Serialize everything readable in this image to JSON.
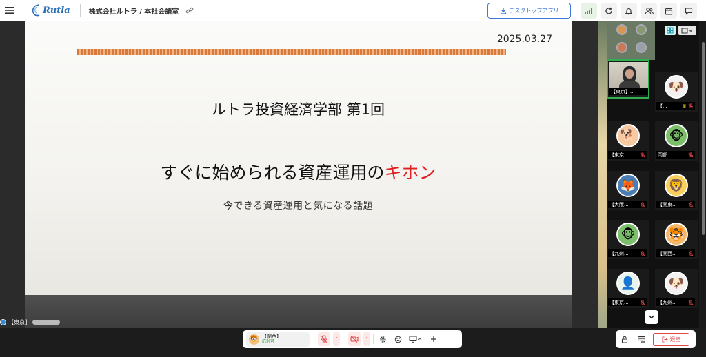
{
  "header": {
    "logo_text": "Rutla",
    "room_title": "株式会社ルトラ / 本社会議室",
    "desktop_app_label": "デスクトップアプリ"
  },
  "slide": {
    "date": "2025.03.27",
    "title": "ルトラ投資経済学部 第1回",
    "headline_main": "すぐに始められる資産運用の",
    "headline_accent": "キホン",
    "subtitle": "今できる資産運用と気になる話題",
    "accent_color": "#e02020",
    "stripe_color": "#d97a3a"
  },
  "self_view": {
    "label": "【東京】"
  },
  "participants": [
    {
      "name": "【東京】...",
      "avatar": "camera-feed",
      "speaking": true,
      "host": false
    },
    {
      "name": "【...",
      "avatar": "pug",
      "speaking": false,
      "host": true
    },
    {
      "name": "【東京...",
      "avatar": "shiba",
      "speaking": false,
      "host": false
    },
    {
      "name": "岡部　...",
      "avatar": "monkey",
      "speaking": false,
      "host": false
    },
    {
      "name": "【大阪...",
      "avatar": "fox",
      "speaking": false,
      "host": false
    },
    {
      "name": "【関東...",
      "avatar": "lion",
      "speaking": false,
      "host": false
    },
    {
      "name": "【九州...",
      "avatar": "monkey",
      "speaking": false,
      "host": false
    },
    {
      "name": "【関西...",
      "avatar": "tiger",
      "speaking": false,
      "host": false
    },
    {
      "name": "【東京...",
      "avatar": "person",
      "speaking": false,
      "host": false
    },
    {
      "name": "【九州...",
      "avatar": "pug",
      "speaking": false,
      "host": false
    }
  ],
  "controls": {
    "me_name": "【関西】",
    "me_status": "応対可",
    "leave_label": "退室"
  },
  "colors": {
    "brand": "#2a6fb8",
    "speaking_border": "#2fb050",
    "mute_red": "#e04545"
  }
}
